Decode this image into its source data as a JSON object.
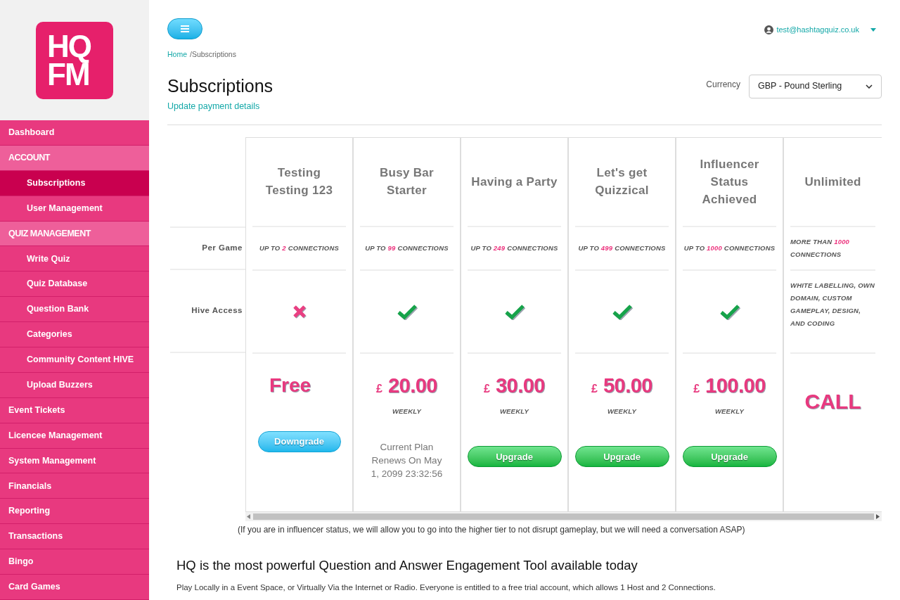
{
  "logo": {
    "line1": "HQ",
    "line2": "FM"
  },
  "sidebar": {
    "items": [
      {
        "kind": "item",
        "label": "Dashboard",
        "selected": false
      },
      {
        "kind": "section",
        "label": "ACCOUNT"
      },
      {
        "kind": "subitem",
        "label": "Subscriptions",
        "selected": true
      },
      {
        "kind": "subitem",
        "label": "User Management",
        "selected": false
      },
      {
        "kind": "section",
        "label": "QUIZ MANAGEMENT"
      },
      {
        "kind": "subitem",
        "label": "Write Quiz",
        "selected": false
      },
      {
        "kind": "subitem",
        "label": "Quiz Database",
        "selected": false
      },
      {
        "kind": "subitem",
        "label": "Question Bank",
        "selected": false
      },
      {
        "kind": "subitem",
        "label": "Categories",
        "selected": false
      },
      {
        "kind": "subitem",
        "label": "Community Content HIVE",
        "selected": false
      },
      {
        "kind": "subitem",
        "label": "Upload Buzzers",
        "selected": false
      },
      {
        "kind": "item",
        "label": "Event Tickets",
        "selected": false
      },
      {
        "kind": "item",
        "label": "Licencee Management",
        "selected": false
      },
      {
        "kind": "item",
        "label": "System Management",
        "selected": false
      },
      {
        "kind": "item",
        "label": "Financials",
        "selected": false
      },
      {
        "kind": "item",
        "label": "Reporting",
        "selected": false
      },
      {
        "kind": "item",
        "label": "Transactions",
        "selected": false
      },
      {
        "kind": "item",
        "label": "Bingo",
        "selected": false
      },
      {
        "kind": "item",
        "label": "Card Games",
        "selected": false
      }
    ]
  },
  "user": {
    "email": "test@hashtagquiz.co.uk"
  },
  "breadcrumb": {
    "home": "Home",
    "current": "/Subscriptions"
  },
  "page": {
    "title": "Subscriptions",
    "link": "Update payment details"
  },
  "currency": {
    "label": "Currency",
    "value": "GBP - Pound Sterling"
  },
  "row_labels": {
    "per_game": "Per Game",
    "hive": "Hive Access"
  },
  "plans": [
    {
      "name": "Testing Testing 123",
      "per_game": {
        "prefix": "UP TO",
        "number": "2",
        "suffix": "CONNECTIONS"
      },
      "hive": {
        "kind": "no"
      },
      "price": {
        "kind": "free",
        "text": "Free"
      },
      "action": {
        "kind": "downgrade",
        "label": "Downgrade"
      }
    },
    {
      "name": "Busy Bar Starter",
      "per_game": {
        "prefix": "UP TO",
        "number": "99",
        "suffix": "CONNECTIONS"
      },
      "hive": {
        "kind": "yes"
      },
      "price": {
        "kind": "amount",
        "currency": "£",
        "amount": "20.00",
        "period": "WEEKLY"
      },
      "action": {
        "kind": "current",
        "text": "Current Plan Renews On May 1, 2099 23:32:56"
      }
    },
    {
      "name": "Having a Party",
      "per_game": {
        "prefix": "UP TO",
        "number": "249",
        "suffix": "CONNECTIONS"
      },
      "hive": {
        "kind": "yes"
      },
      "price": {
        "kind": "amount",
        "currency": "£",
        "amount": "30.00",
        "period": "WEEKLY"
      },
      "action": {
        "kind": "upgrade",
        "label": "Upgrade"
      }
    },
    {
      "name": "Let's get Quizzical",
      "per_game": {
        "prefix": "UP TO",
        "number": "499",
        "suffix": "CONNECTIONS"
      },
      "hive": {
        "kind": "yes"
      },
      "price": {
        "kind": "amount",
        "currency": "£",
        "amount": "50.00",
        "period": "WEEKLY"
      },
      "action": {
        "kind": "upgrade",
        "label": "Upgrade"
      }
    },
    {
      "name": "Influencer Status Achieved",
      "per_game": {
        "prefix": "UP TO",
        "number": "1000",
        "suffix": "CONNECTIONS"
      },
      "hive": {
        "kind": "yes"
      },
      "price": {
        "kind": "amount",
        "currency": "£",
        "amount": "100.00",
        "period": "WEEKLY"
      },
      "action": {
        "kind": "upgrade",
        "label": "Upgrade"
      }
    },
    {
      "name": "Unlimited",
      "per_game": {
        "prefix": "MORE THAN",
        "number": "1000",
        "suffix": "CONNECTIONS"
      },
      "hive": {
        "kind": "text",
        "text": "WHITE LABELLING, OWN DOMAIN, CUSTOM GAMEPLAY, DESIGN, AND CODING"
      },
      "price": {
        "kind": "call",
        "text": "CALL"
      }
    }
  ],
  "note": "(If you are in influencer status, we will allow you to go into the higher tier to not disrupt gameplay, but we will need a conversation ASAP)",
  "footer": {
    "heading": "HQ is the most powerful Question and Answer Engagement Tool available today",
    "text": "Play Locally in a Event Space, or Virtually Via the Internet or Radio. Everyone is entitled to a free trial account, which allows 1 Host and 2 Connections."
  }
}
